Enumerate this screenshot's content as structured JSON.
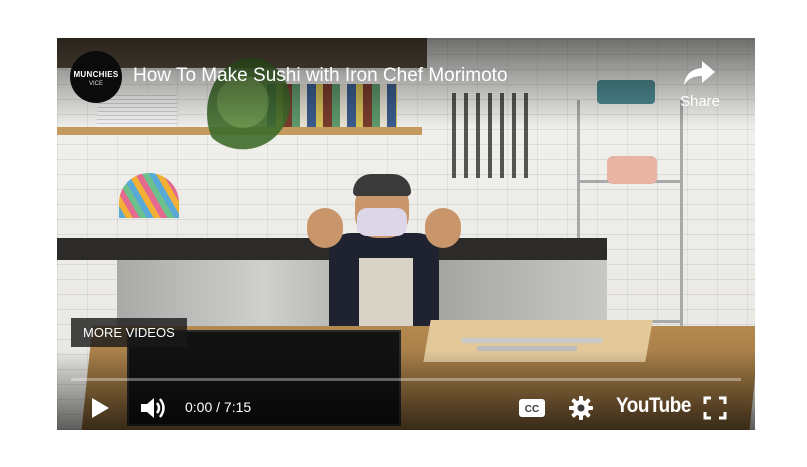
{
  "video": {
    "title": "How To Make Sushi with Iron Chef Morimoto",
    "channel_avatar_text": "MUNCHIES",
    "channel_avatar_subtext": "VICE",
    "share_label": "Share",
    "more_videos_label": "MORE VIDEOS",
    "time_display": "0:00 / 7:15",
    "progress_fraction": 0,
    "youtube_logo_text": "YouTube"
  },
  "icons": {
    "play": "play-icon",
    "volume": "volume-icon",
    "captions": "captions-icon",
    "settings": "gear-icon",
    "fullscreen": "fullscreen-icon",
    "share": "share-arrow-icon"
  },
  "colors": {
    "progress_played": "#ff0000",
    "overlay_text": "#ffffff"
  }
}
